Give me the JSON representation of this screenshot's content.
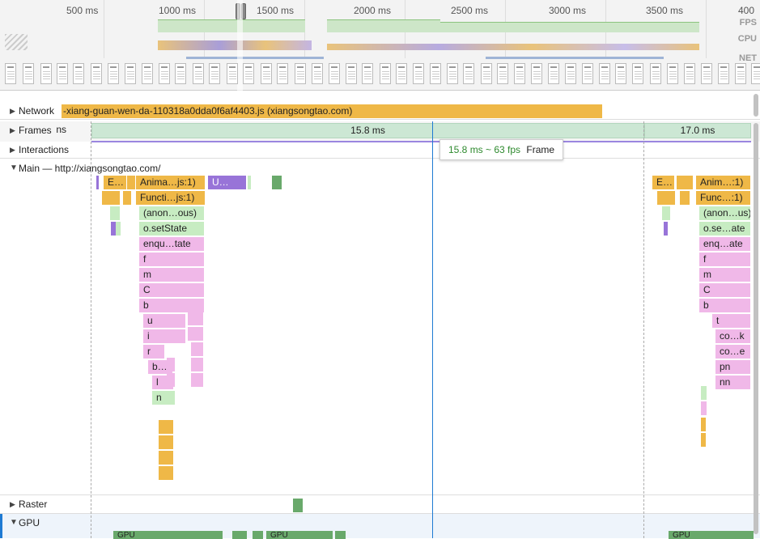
{
  "overview": {
    "ticks": [
      "500 ms",
      "1000 ms",
      "1500 ms",
      "2000 ms",
      "2500 ms",
      "3000 ms",
      "3500 ms",
      "400"
    ],
    "lanes": {
      "fps": "FPS",
      "cpu": "CPU",
      "net": "NET"
    }
  },
  "network": {
    "label": "Network",
    "resource": "-xiang-guan-wen-da-110318a0dda0f6af4403.js (xiangsongtao.com)"
  },
  "frames": {
    "label": "Frames",
    "left_partial": "ns",
    "center": "15.8 ms",
    "right": "17.0 ms"
  },
  "interactions": {
    "label": "Interactions"
  },
  "tooltip": {
    "value": "15.8 ms ~ 63 fps",
    "kind": "Frame"
  },
  "main": {
    "label": "Main — http://xiangsongtao.com/",
    "left_stack": [
      "Anima…js:1)",
      "Functi…js:1)",
      "(anon…ous)",
      "o.setState",
      "enqu…tate",
      "f",
      "m",
      "C",
      "b",
      "u",
      "i",
      "r",
      "b…",
      "l",
      "n"
    ],
    "left_small": [
      "E…",
      "U…"
    ],
    "right_stack": [
      "Anim…:1)",
      "Func…:1)",
      "(anon…us)",
      "o.se…ate",
      "enq…ate",
      "f",
      "m",
      "C",
      "b",
      "t",
      "co…k",
      "co…e",
      "pn",
      "nn"
    ],
    "right_small": [
      "E…"
    ]
  },
  "raster": {
    "label": "Raster"
  },
  "gpu": {
    "label": "GPU",
    "bars": [
      "GPU",
      "GPU",
      "GPU"
    ]
  },
  "colors": {
    "scripting": "#efb847",
    "rendering": "#9874d8",
    "painting": "#69a96b",
    "selection": "#1e7ad3"
  }
}
